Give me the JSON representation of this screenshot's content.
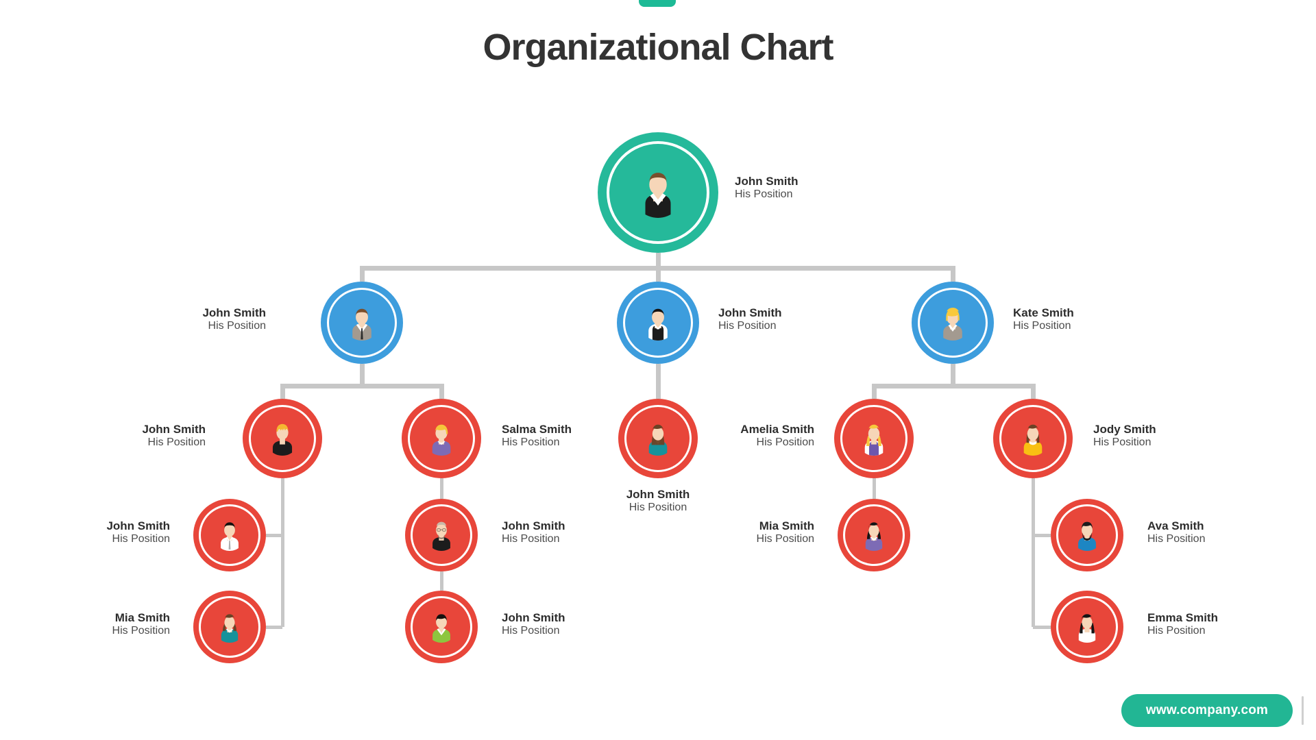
{
  "page": {
    "title": "Organizational Chart",
    "background": "#ffffff",
    "title_color": "#333333"
  },
  "decor": {
    "top_tab_color": "#1dba96"
  },
  "colors": {
    "root": "#25b99a",
    "level2": "#3d9ddd",
    "level3": "#e8463a",
    "connector": "#c7c7c7",
    "footer": "#22b694"
  },
  "footer": {
    "url": "www.company.com"
  },
  "chart_data": {
    "type": "diagram",
    "title": "Organizational Chart",
    "nodes": [
      {
        "id": "n0",
        "name": "John Smith",
        "position": "His Position",
        "level": 1,
        "color": "#25b99a",
        "label_side": "right",
        "avatar": "man-brown-hair-black-suit"
      },
      {
        "id": "n1",
        "name": "John Smith",
        "position": "His Position",
        "level": 2,
        "color": "#3d9ddd",
        "label_side": "left",
        "avatar": "man-brown-hair-grey-suit"
      },
      {
        "id": "n2",
        "name": "John Smith",
        "position": "His Position",
        "level": 2,
        "color": "#3d9ddd",
        "label_side": "right",
        "avatar": "man-black-hair-bowtie-vest"
      },
      {
        "id": "n3",
        "name": "Kate Smith",
        "position": "His Position",
        "level": 2,
        "color": "#3d9ddd",
        "label_side": "right",
        "avatar": "woman-blonde-bob-grey-jacket"
      },
      {
        "id": "n4",
        "name": "John Smith",
        "position": "His Position",
        "level": 3,
        "color": "#e8463a",
        "label_side": "left",
        "avatar": "man-blonde-spiky-black-shirt"
      },
      {
        "id": "n5",
        "name": "Salma Smith",
        "position": "His Position",
        "level": 3,
        "color": "#e8463a",
        "label_side": "right",
        "avatar": "woman-blonde-purple-top"
      },
      {
        "id": "n6",
        "name": "John Smith",
        "position": "His Position",
        "level": 3,
        "color": "#e8463a",
        "label_side": "below",
        "avatar": "woman-brown-hair-teal-top"
      },
      {
        "id": "n7",
        "name": "Amelia Smith",
        "position": "His Position",
        "level": 3,
        "color": "#e8463a",
        "label_side": "left",
        "avatar": "woman-blonde-long-purple-vest"
      },
      {
        "id": "n8",
        "name": "Jody Smith",
        "position": "His Position",
        "level": 3,
        "color": "#e8463a",
        "label_side": "right",
        "avatar": "woman-brown-bob-yellow-top"
      },
      {
        "id": "n9",
        "name": "John Smith",
        "position": "His Position",
        "level": 4,
        "color": "#e8463a",
        "label_side": "left",
        "avatar": "man-black-hair-white-shirt-tie"
      },
      {
        "id": "n10",
        "name": "Mia Smith",
        "position": "His Position",
        "level": 4,
        "color": "#e8463a",
        "label_side": "left",
        "avatar": "woman-brown-ponytail-teal-top"
      },
      {
        "id": "n11",
        "name": "John Smith",
        "position": "His Position",
        "level": 4,
        "color": "#e8463a",
        "label_side": "right",
        "avatar": "man-bald-glasses-beard-black-shirt"
      },
      {
        "id": "n12",
        "name": "John Smith",
        "position": "His Position",
        "level": 4,
        "color": "#e8463a",
        "label_side": "right",
        "avatar": "man-black-hair-green-sweater"
      },
      {
        "id": "n13",
        "name": "Mia Smith",
        "position": "His Position",
        "level": 4,
        "color": "#e8463a",
        "label_side": "left",
        "avatar": "woman-black-hair-purple-top"
      },
      {
        "id": "n14",
        "name": "Ava Smith",
        "position": "His Position",
        "level": 4,
        "color": "#e8463a",
        "label_side": "right",
        "avatar": "man-beard-blue-shirt"
      },
      {
        "id": "n15",
        "name": "Emma Smith",
        "position": "His Position",
        "level": 4,
        "color": "#e8463a",
        "label_side": "right",
        "avatar": "woman-long-black-hair-white-top"
      }
    ],
    "edges": [
      {
        "from": "n0",
        "to": "n1"
      },
      {
        "from": "n0",
        "to": "n2"
      },
      {
        "from": "n0",
        "to": "n3"
      },
      {
        "from": "n1",
        "to": "n4"
      },
      {
        "from": "n1",
        "to": "n5"
      },
      {
        "from": "n2",
        "to": "n6"
      },
      {
        "from": "n3",
        "to": "n7"
      },
      {
        "from": "n3",
        "to": "n8"
      },
      {
        "from": "n4",
        "to": "n9"
      },
      {
        "from": "n4",
        "to": "n10"
      },
      {
        "from": "n5",
        "to": "n11"
      },
      {
        "from": "n11",
        "to": "n12"
      },
      {
        "from": "n7",
        "to": "n13"
      },
      {
        "from": "n8",
        "to": "n14"
      },
      {
        "from": "n8",
        "to": "n15"
      }
    ]
  }
}
